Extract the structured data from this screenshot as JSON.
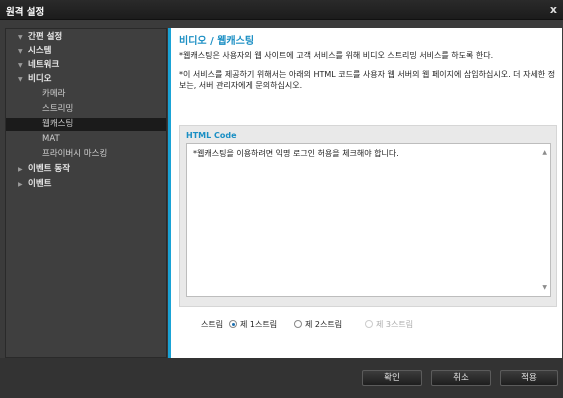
{
  "window": {
    "title": "원격 설정",
    "close_glyph": "x"
  },
  "sidebar": {
    "items": [
      {
        "label": "간편 설정",
        "arrow": "▼"
      },
      {
        "label": "시스템",
        "arrow": "▼"
      },
      {
        "label": "네트워크",
        "arrow": "▼"
      },
      {
        "label": "비디오",
        "arrow": "▼"
      },
      {
        "label": "카메라"
      },
      {
        "label": "스트리밍"
      },
      {
        "label": "웹캐스팅"
      },
      {
        "label": "MAT"
      },
      {
        "label": "프라이버시 마스킹"
      },
      {
        "label": "이벤트 동작",
        "arrow": "▶"
      },
      {
        "label": "이벤트",
        "arrow": "▶"
      }
    ]
  },
  "content": {
    "heading": "비디오 / 웹캐스팅",
    "description1": "*웹캐스팅은 사용자의 웹 사이트에 고객 서비스를 위해 비디오 스트리밍 서비스를 하도록 한다.",
    "description2": "*이 서비스를 제공하기 위해서는 아래의 HTML 코드를 사용자 웹 서버의 웹 페이지에 삽입하십시오. 더 자세한 정보는, 서버 관리자에게 문의하십시오.",
    "html_code_label": "HTML Code",
    "html_code_text": "*웹캐스팅을 이용하려면 익명 로그인 허용을 체크해야 합니다.",
    "stream_label": "스트림",
    "stream_options": [
      {
        "label": "제 1스트림",
        "selected": true,
        "enabled": true
      },
      {
        "label": "제 2스트림",
        "selected": false,
        "enabled": true
      },
      {
        "label": "제 3스트림",
        "selected": false,
        "enabled": false
      }
    ]
  },
  "footer": {
    "confirm_label": "확인",
    "cancel_label": "취소",
    "apply_label": "적용"
  },
  "colors": {
    "accent": "#1aa3d6",
    "heading": "#1b8fc4"
  }
}
